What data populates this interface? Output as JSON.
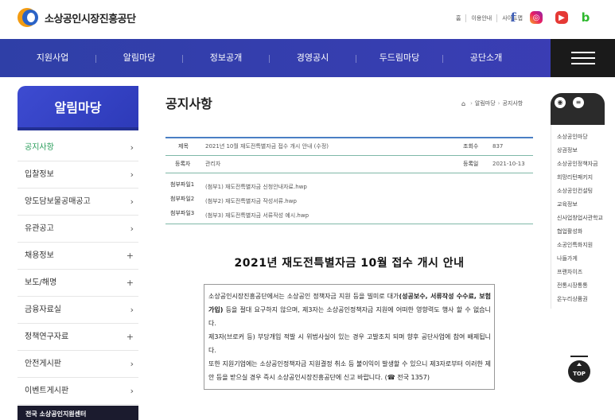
{
  "header": {
    "logo_text": "소상공인시장진흥공단",
    "util_links": [
      "홈",
      "이용안내",
      "사이트맵"
    ],
    "sns": [
      {
        "name": "facebook",
        "glyph": "f"
      },
      {
        "name": "instagram",
        "glyph": "◎"
      },
      {
        "name": "youtube",
        "glyph": "▶"
      },
      {
        "name": "blog",
        "glyph": "b"
      }
    ]
  },
  "gnb": {
    "items": [
      "지원사업",
      "알림마당",
      "정보공개",
      "경영공시",
      "두드림마당",
      "공단소개"
    ]
  },
  "sidebar": {
    "title": "알림마당",
    "items": [
      {
        "label": "공지사항",
        "mark": "›"
      },
      {
        "label": "입찰정보",
        "mark": "›"
      },
      {
        "label": "양도담보물공매공고",
        "mark": "›"
      },
      {
        "label": "유관공고",
        "mark": "›"
      },
      {
        "label": "채용정보",
        "mark": "+"
      },
      {
        "label": "보도/해명",
        "mark": "+"
      },
      {
        "label": "금융자료실",
        "mark": "›"
      },
      {
        "label": "정책연구자료",
        "mark": "+"
      },
      {
        "label": "안전게시판",
        "mark": "›"
      },
      {
        "label": "이벤트게시판",
        "mark": "›"
      }
    ],
    "bottom_label": "전국 소상공인지원센터"
  },
  "content": {
    "title": "공지사항",
    "breadcrumb": [
      "알림마당",
      "공지사항"
    ],
    "info": {
      "subject_label": "제목",
      "subject": "2021년 10월 재도전특별자금 접수 개시 안내 (수정)",
      "views_label": "조회수",
      "views": "837",
      "author_label": "등록자",
      "author": "관리자",
      "date_label": "등록일",
      "date": "2021-10-13"
    },
    "files": [
      {
        "label": "첨부파일1",
        "name": "(첨부1) 재도전특별자금 신청안내자료.hwp"
      },
      {
        "label": "첨부파일2",
        "name": "(첨부2) 재도전특별자금 작성서류.hwp"
      },
      {
        "label": "첨부파일3",
        "name": "(첨부3) 재도전특별자금 서류작성 예시.hwp"
      }
    ],
    "headline": "2021년 재도전특별자금 10월 접수 개시 안내",
    "notice": {
      "p1_a": "소상공인시장진흥공단에서는 소상공인 정책자금 지원 등을 빌미로 대가",
      "p1_bold": "(성공보수, 서류작성 수수료, 보험가입)",
      "p1_b": " 등을 절대 요구하지 않으며, 제3자는 소상공인정책자금 지원에 어떠한 영향력도 행사 할 수 없습니다.",
      "p2": "제3자(브로커 등) 부당개입 적발 시 위법사실이 있는 경우 고발조치 되며 향후 공단사업에 참여 배제됩니다.",
      "p3": "또한 지원기업에는 소상공인정책자금 지원결정 취소 등 불이익이 발생할 수 있으니 제3자로부터 이러한 제안 등을 받으실 경우 즉시 소상공인시장진흥공단에 신고 바랍니다. (☎ 전국 1357)"
    }
  },
  "quick": {
    "items": [
      "소상공인마당",
      "상권정보",
      "소상공인정책자금",
      "희망리턴패키지",
      "소상공인컨설팅",
      "교육정보",
      "신사업창업사관학교",
      "협업활성화",
      "소공인특화지원",
      "나들가게",
      "프랜차이즈",
      "전통시장통통",
      "온누리상품권"
    ],
    "top_label": "TOP"
  }
}
